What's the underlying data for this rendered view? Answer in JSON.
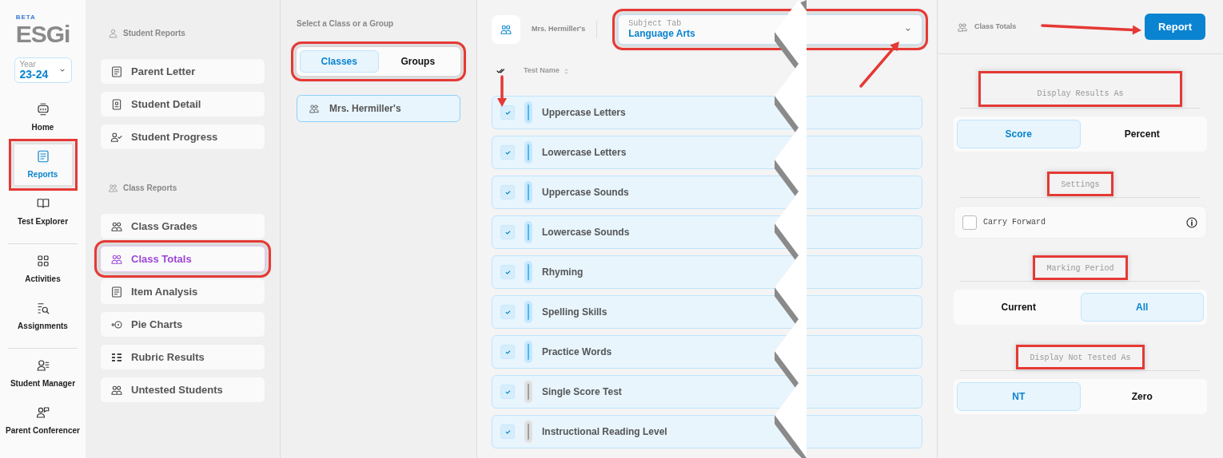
{
  "nav": {
    "logo_badge": "BETA",
    "logo": "ESGi",
    "year_label": "Year",
    "year": "23-24",
    "groups": [
      [
        {
          "label": "Home",
          "selected": false,
          "highlighted": false
        },
        {
          "label": "Reports",
          "selected": true,
          "highlighted": true
        },
        {
          "label": "Test Explorer",
          "selected": false,
          "highlighted": false
        }
      ],
      [
        {
          "label": "Activities",
          "selected": false,
          "highlighted": false
        },
        {
          "label": "Assignments",
          "selected": false,
          "highlighted": false
        }
      ],
      [
        {
          "label": "Student Manager",
          "selected": false,
          "highlighted": false
        },
        {
          "label": "Parent Conferencer",
          "selected": false,
          "highlighted": false
        }
      ]
    ]
  },
  "reports": {
    "sections": [
      {
        "title": "Student Reports",
        "items": [
          {
            "label": "Parent Letter",
            "selected": false,
            "highlighted": false
          },
          {
            "label": "Student Detail",
            "selected": false,
            "highlighted": false
          },
          {
            "label": "Student Progress",
            "selected": false,
            "highlighted": false
          }
        ]
      },
      {
        "title": "Class Reports",
        "items": [
          {
            "label": "Class Grades",
            "selected": false,
            "highlighted": false
          },
          {
            "label": "Class Totals",
            "selected": true,
            "highlighted": true
          },
          {
            "label": "Item Analysis",
            "selected": false,
            "highlighted": false
          },
          {
            "label": "Pie Charts",
            "selected": false,
            "highlighted": false
          },
          {
            "label": "Rubric Results",
            "selected": false,
            "highlighted": false
          },
          {
            "label": "Untested Students",
            "selected": false,
            "highlighted": false
          }
        ]
      }
    ]
  },
  "class_picker": {
    "heading": "Select a Class or a Group",
    "highlighted": true,
    "options": [
      {
        "label": "Classes",
        "selected": true
      },
      {
        "label": "Groups",
        "selected": false
      }
    ],
    "classes": [
      {
        "label": "Mrs. Hermiller's",
        "selected": true
      }
    ]
  },
  "main": {
    "class_name": "Mrs. Hermiller's",
    "subject": {
      "label": "Subject Tab",
      "value": "Language Arts",
      "highlighted": true
    },
    "column": "Test Name",
    "tests": [
      {
        "name": "Uppercase Letters",
        "checked": true,
        "color": "#4db6f2"
      },
      {
        "name": "Lowercase Letters",
        "checked": true,
        "color": "#4db6f2"
      },
      {
        "name": "Uppercase Sounds",
        "checked": true,
        "color": "#4db6f2"
      },
      {
        "name": "Lowercase Sounds",
        "checked": true,
        "color": "#4db6f2"
      },
      {
        "name": "Rhyming",
        "checked": true,
        "color": "#4db6f2"
      },
      {
        "name": "Spelling Skills",
        "checked": true,
        "color": "#4db6f2"
      },
      {
        "name": "Practice Words",
        "checked": true,
        "color": "#4db6f2"
      },
      {
        "name": "Single Score Test",
        "checked": true,
        "color": "#9e9e9e"
      },
      {
        "name": "Instructional Reading Level",
        "checked": true,
        "color": "#9e9e9e"
      }
    ]
  },
  "settings": {
    "title": "Class Totals",
    "button": "Report",
    "sections": [
      {
        "kind": "toggle",
        "title": "Display Results As",
        "highlighted": true,
        "options": [
          {
            "label": "Score",
            "selected": true
          },
          {
            "label": "Percent",
            "selected": false
          }
        ]
      },
      {
        "kind": "checkbox",
        "title": "Settings",
        "highlighted": true,
        "label": "Carry Forward",
        "checked": false
      },
      {
        "kind": "toggle",
        "title": "Marking Period",
        "highlighted": true,
        "options": [
          {
            "label": "Current",
            "selected": false
          },
          {
            "label": "All",
            "selected": true
          }
        ]
      },
      {
        "kind": "toggle",
        "title": "Display Not Tested As",
        "highlighted": true,
        "options": [
          {
            "label": "NT",
            "selected": true
          },
          {
            "label": "Zero",
            "selected": false
          }
        ]
      }
    ]
  }
}
